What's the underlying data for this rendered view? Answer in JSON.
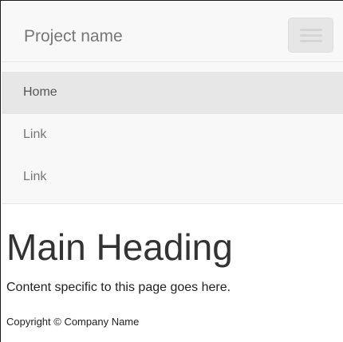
{
  "navbar": {
    "brand": "Project name",
    "toggle_icon": "hamburger-icon",
    "items": [
      {
        "label": "Home",
        "active": true
      },
      {
        "label": "Link",
        "active": false
      },
      {
        "label": "Link",
        "active": false
      }
    ]
  },
  "main": {
    "heading": "Main Heading",
    "content": "Content specific to this page goes here."
  },
  "footer": {
    "copyright": "Copyright © Company Name"
  },
  "colors": {
    "navbar_bg": "#f8f8f8",
    "active_item_bg": "#e7e7e7",
    "nav_text": "#777777",
    "heading_text": "#333333"
  }
}
